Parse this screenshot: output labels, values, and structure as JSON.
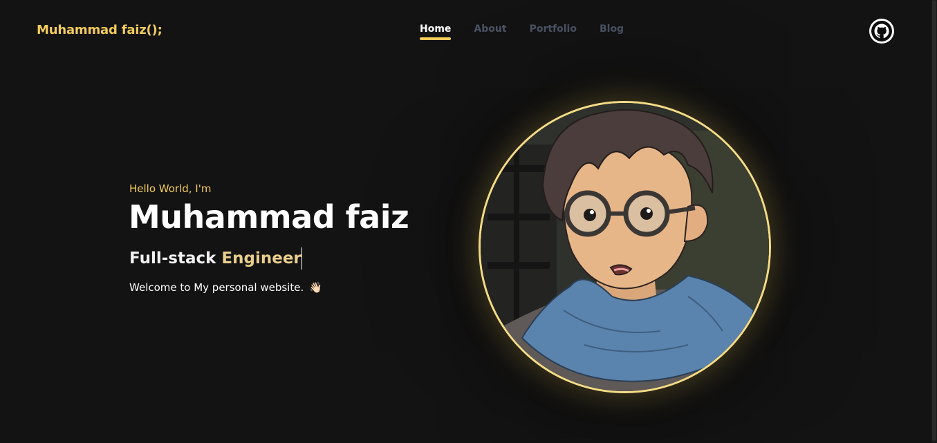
{
  "header": {
    "brand": "Muhammad faiz();",
    "nav": [
      {
        "label": "Home",
        "active": true
      },
      {
        "label": "About",
        "active": false
      },
      {
        "label": "Portfolio",
        "active": false
      },
      {
        "label": "Blog",
        "active": false
      }
    ],
    "github_icon": "github-icon"
  },
  "hero": {
    "greeting": "Hello World, I'm",
    "name": "Muhammad faiz",
    "role_prefix": "Full-stack ",
    "role_highlight": "Engineer",
    "welcome": "Welcome to My personal website.",
    "wave_emoji": "👋🏻",
    "avatar_icon": "anime-boy-avatar"
  },
  "colors": {
    "background": "#131313",
    "accent": "#f3cc5c",
    "nav_inactive": "#4b5365",
    "avatar_border": "#f5dc86"
  }
}
